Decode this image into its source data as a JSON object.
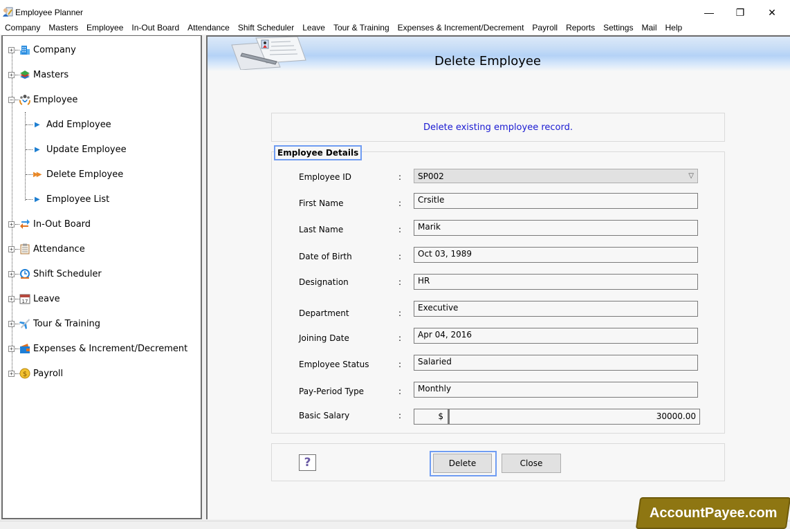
{
  "window": {
    "title": "Employee Planner",
    "controls": {
      "minimize": "—",
      "restore": "❐",
      "close": "✕"
    }
  },
  "menubar": {
    "items": [
      "Company",
      "Masters",
      "Employee",
      "In-Out Board",
      "Attendance",
      "Shift Scheduler",
      "Leave",
      "Tour & Training",
      "Expenses & Increment/Decrement",
      "Payroll",
      "Reports",
      "Settings",
      "Mail",
      "Help"
    ]
  },
  "sidebar": {
    "nodes": [
      {
        "label": "Company",
        "icon": "building-icon",
        "expander": "+"
      },
      {
        "label": "Masters",
        "icon": "layers-icon",
        "expander": "+"
      },
      {
        "label": "Employee",
        "icon": "employee-group-icon",
        "expander": "−"
      },
      {
        "label": "In-Out Board",
        "icon": "in-out-arrows-icon",
        "expander": "+"
      },
      {
        "label": "Attendance",
        "icon": "clipboard-icon",
        "expander": "+"
      },
      {
        "label": "Shift Scheduler",
        "icon": "clock-icon",
        "expander": "+"
      },
      {
        "label": "Leave",
        "icon": "calendar-icon",
        "expander": "+"
      },
      {
        "label": "Tour & Training",
        "icon": "airplane-icon",
        "expander": "+"
      },
      {
        "label": "Expenses & Increment/Decrement",
        "icon": "wallet-icon",
        "expander": "+"
      },
      {
        "label": "Payroll",
        "icon": "dollar-coin-icon",
        "expander": "+"
      }
    ],
    "employee_children": [
      {
        "label": "Add Employee",
        "active": false
      },
      {
        "label": "Update Employee",
        "active": false
      },
      {
        "label": "Delete Employee",
        "active": true
      },
      {
        "label": "Employee List",
        "active": false
      }
    ],
    "calendar_day": "17"
  },
  "main": {
    "page_title": "Delete Employee",
    "description": "Delete existing employee record.",
    "section_title": "Employee Details",
    "fields": {
      "employee_id": {
        "label": "Employee ID",
        "value": "SP002"
      },
      "first_name": {
        "label": "First Name",
        "value": "Crsitle"
      },
      "last_name": {
        "label": "Last Name",
        "value": "Marik"
      },
      "dob": {
        "label": "Date of Birth",
        "value": "Oct 03, 1989"
      },
      "designation": {
        "label": "Designation",
        "value": "HR"
      },
      "department": {
        "label": "Department",
        "value": "Executive"
      },
      "joining_date": {
        "label": "Joining Date",
        "value": "Apr 04, 2016"
      },
      "status": {
        "label": "Employee Status",
        "value": "Salaried"
      },
      "pay_period": {
        "label": "Pay-Period Type",
        "value": "Monthly"
      },
      "basic_salary": {
        "label": "Basic Salary",
        "currency": "$",
        "value": "30000.00"
      }
    },
    "colon": ":",
    "buttons": {
      "help": "?",
      "delete": "Delete",
      "close": "Close"
    }
  },
  "watermark": "AccountPayee.com",
  "colors": {
    "accent_focus": "#6f9cf2",
    "description_text": "#1a1ad2",
    "watermark_bg": "#8e7612"
  }
}
